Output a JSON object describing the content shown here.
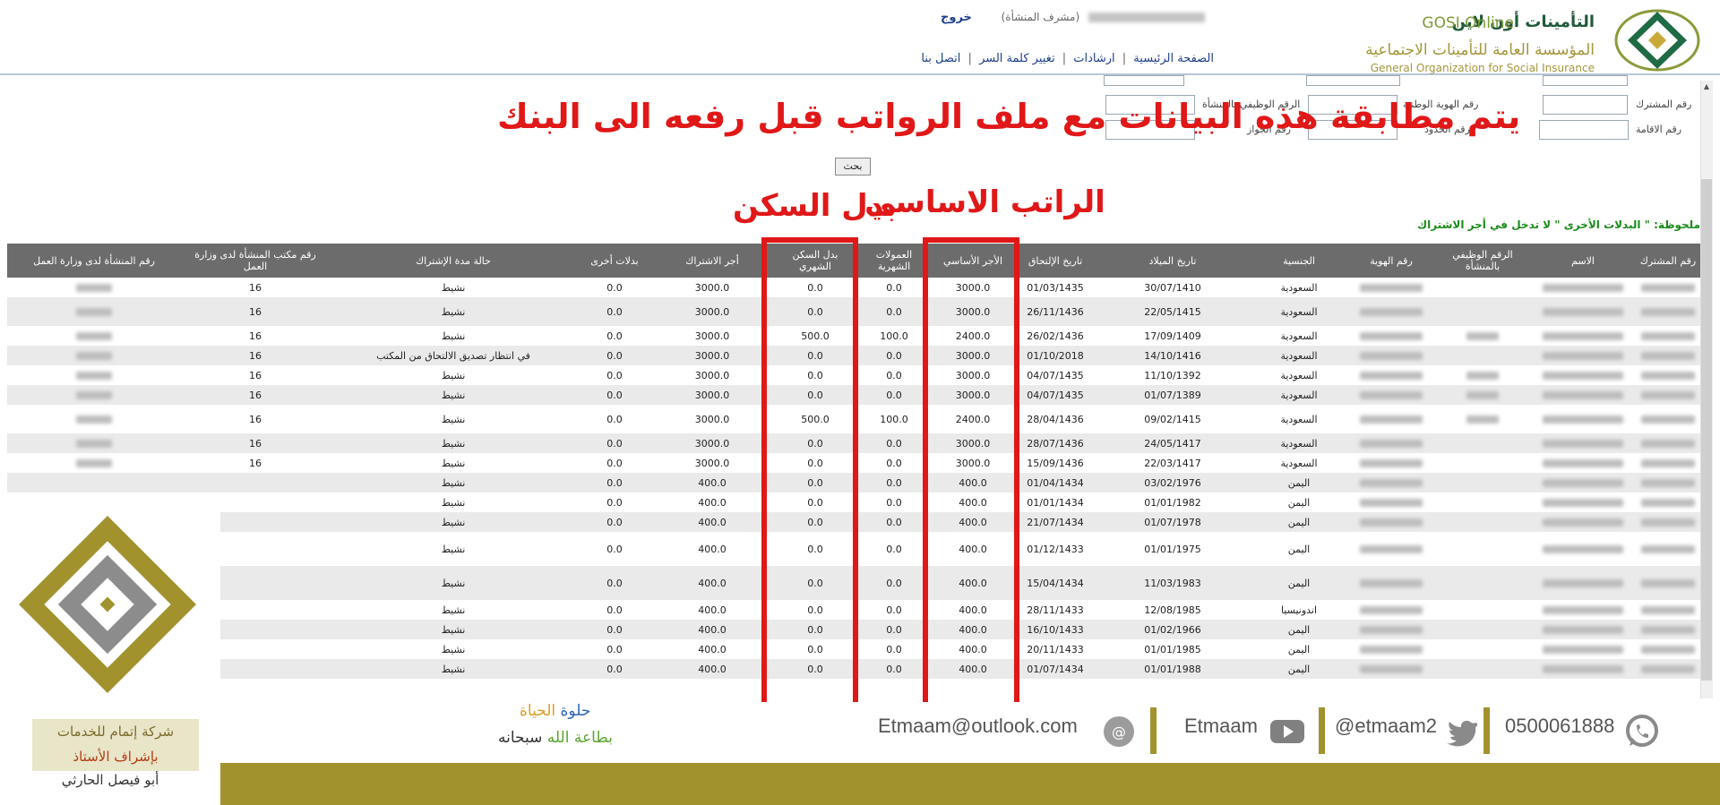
{
  "header": {
    "brand_ar": "التأمينات أون لاين",
    "brand_en": "GOSI Online",
    "org_ar": "المؤسسة العامة للتأمينات الاجتماعية",
    "org_en": "General Organization for Social Insurance",
    "user_role": "(مشرف المنشأة)",
    "logout": "خروج",
    "nav": [
      "الصفحة الرئيسية",
      "ارشادات",
      "تغيير كلمة السر",
      "اتصل بنا"
    ]
  },
  "search_form": {
    "labels": {
      "subscriber_no": "رقم المشترك",
      "national_id": "رقم الهوية الوطنية",
      "employee_no": "الرقم الوظيفي بالمنشأة",
      "iqama_no": "رقم الاقامة",
      "border_no": "رقم الحدود",
      "passport_no": "رقم الجواز"
    },
    "search_button": "بحث"
  },
  "annotations": {
    "main": "يتم مطابقة هذه البيانات مع ملف الرواتب قبل رفعه الى البنك",
    "basic_salary": "الراتب الاساسي",
    "housing": "بدل السكن"
  },
  "note": "ملحوظة: \" البدلات الأخرى \" لا تدخل في أجر الاشتراك",
  "table": {
    "headers": {
      "sub_no": "رقم المشترك",
      "name": "الاسم",
      "emp_no": "الرقم الوظيفي بالمنشأة",
      "id_no": "رقم الهوية",
      "nationality": "الجنسية",
      "birth": "تاريخ الميلاد",
      "join": "تاريخ الإلتحاق",
      "basic": "الأجر الأساسي",
      "commission": "العمولات الشهرية",
      "housing": "بدل السكن الشهري",
      "sub_wage": "أجر الاشتراك",
      "other": "بدلات أخرى",
      "status": "حالة مدة الإشتراك",
      "labor_office": "رقم مكتب المنشأة لدى وزارة العمل",
      "labor_no": "رقم المنشأة لدى وزارة العمل"
    },
    "rows": [
      {
        "nat": "السعودية",
        "birth": "30/07/1410",
        "join": "01/03/1435",
        "basic": "3000.0",
        "comm": "0.0",
        "housing": "0.0",
        "wage": "3000.0",
        "other": "0.0",
        "status": "نشيط",
        "office": "16"
      },
      {
        "nat": "السعودية",
        "birth": "22/05/1415",
        "join": "26/11/1436",
        "basic": "3000.0",
        "comm": "0.0",
        "housing": "0.0",
        "wage": "3000.0",
        "other": "0.0",
        "status": "نشيط",
        "office": "16"
      },
      {
        "nat": "السعودية",
        "birth": "17/09/1409",
        "join": "26/02/1436",
        "basic": "2400.0",
        "comm": "100.0",
        "housing": "500.0",
        "wage": "3000.0",
        "other": "0.0",
        "status": "نشيط",
        "office": "16"
      },
      {
        "nat": "السعودية",
        "birth": "14/10/1416",
        "join": "01/10/2018",
        "basic": "3000.0",
        "comm": "0.0",
        "housing": "0.0",
        "wage": "3000.0",
        "other": "0.0",
        "status": "في انتظار تصديق الالتحاق من المكتب",
        "office": "16"
      },
      {
        "nat": "السعودية",
        "birth": "11/10/1392",
        "join": "04/07/1435",
        "basic": "3000.0",
        "comm": "0.0",
        "housing": "0.0",
        "wage": "3000.0",
        "other": "0.0",
        "status": "نشيط",
        "office": "16"
      },
      {
        "nat": "السعودية",
        "birth": "01/07/1389",
        "join": "04/07/1435",
        "basic": "3000.0",
        "comm": "0.0",
        "housing": "0.0",
        "wage": "3000.0",
        "other": "0.0",
        "status": "نشيط",
        "office": "16"
      },
      {
        "nat": "السعودية",
        "birth": "09/02/1415",
        "join": "28/04/1436",
        "basic": "2400.0",
        "comm": "100.0",
        "housing": "500.0",
        "wage": "3000.0",
        "other": "0.0",
        "status": "نشيط",
        "office": "16"
      },
      {
        "nat": "السعودية",
        "birth": "24/05/1417",
        "join": "28/07/1436",
        "basic": "3000.0",
        "comm": "0.0",
        "housing": "0.0",
        "wage": "3000.0",
        "other": "0.0",
        "status": "نشيط",
        "office": "16"
      },
      {
        "nat": "السعودية",
        "birth": "22/03/1417",
        "join": "15/09/1436",
        "basic": "3000.0",
        "comm": "0.0",
        "housing": "0.0",
        "wage": "3000.0",
        "other": "0.0",
        "status": "نشيط",
        "office": "16"
      },
      {
        "nat": "اليمن",
        "birth": "03/02/1976",
        "join": "01/04/1434",
        "basic": "400.0",
        "comm": "0.0",
        "housing": "0.0",
        "wage": "400.0",
        "other": "0.0",
        "status": "نشيط",
        "office": ""
      },
      {
        "nat": "اليمن",
        "birth": "01/01/1982",
        "join": "01/01/1434",
        "basic": "400.0",
        "comm": "0.0",
        "housing": "0.0",
        "wage": "400.0",
        "other": "0.0",
        "status": "نشيط",
        "office": ""
      },
      {
        "nat": "اليمن",
        "birth": "01/07/1978",
        "join": "21/07/1434",
        "basic": "400.0",
        "comm": "0.0",
        "housing": "0.0",
        "wage": "400.0",
        "other": "0.0",
        "status": "نشيط",
        "office": ""
      },
      {
        "nat": "اليمن",
        "birth": "01/01/1975",
        "join": "01/12/1433",
        "basic": "400.0",
        "comm": "0.0",
        "housing": "0.0",
        "wage": "400.0",
        "other": "0.0",
        "status": "نشيط",
        "office": ""
      },
      {
        "nat": "اليمن",
        "birth": "11/03/1983",
        "join": "15/04/1434",
        "basic": "400.0",
        "comm": "0.0",
        "housing": "0.0",
        "wage": "400.0",
        "other": "0.0",
        "status": "نشيط",
        "office": ""
      },
      {
        "nat": "اندونيسيا",
        "birth": "12/08/1985",
        "join": "28/11/1433",
        "basic": "400.0",
        "comm": "0.0",
        "housing": "0.0",
        "wage": "400.0",
        "other": "0.0",
        "status": "نشيط",
        "office": ""
      },
      {
        "nat": "اليمن",
        "birth": "01/02/1966",
        "join": "16/10/1433",
        "basic": "400.0",
        "comm": "0.0",
        "housing": "0.0",
        "wage": "400.0",
        "other": "0.0",
        "status": "نشيط",
        "office": ""
      },
      {
        "nat": "اليمن",
        "birth": "01/01/1985",
        "join": "20/11/1433",
        "basic": "400.0",
        "comm": "0.0",
        "housing": "0.0",
        "wage": "400.0",
        "other": "0.0",
        "status": "نشيط",
        "office": ""
      },
      {
        "nat": "اليمن",
        "birth": "01/01/1988",
        "join": "01/07/1434",
        "basic": "400.0",
        "comm": "0.0",
        "housing": "0.0",
        "wage": "400.0",
        "other": "0.0",
        "status": "نشيط",
        "office": ""
      }
    ]
  },
  "branding": {
    "company": "شركة إتمام للخدمات",
    "supervision": "بإشراف الأستاذ",
    "person": "أبو فيصل الحارثي",
    "slogan_life": "الحياة",
    "slogan_sweet": "حلوة",
    "slogan_obedience": "بطاعة الله",
    "slogan_subhanah": "سبحانه",
    "email": "Etmaam@outlook.com",
    "youtube": "Etmaam",
    "twitter": "@etmaam2",
    "whatsapp": "0500061888"
  },
  "colors": {
    "annotation_red": "#e01818",
    "olive": "#a1922e",
    "table_header": "#6c6c6c"
  }
}
